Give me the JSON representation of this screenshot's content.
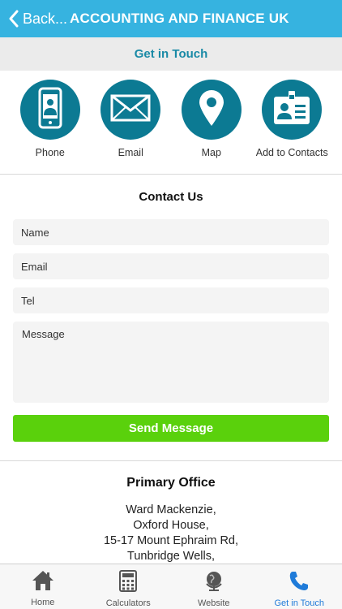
{
  "header": {
    "back_label": "Back...",
    "title": "ACCOUNTING AND FINANCE UK"
  },
  "subheader": {
    "title": "Get in Touch"
  },
  "actions": [
    {
      "label": "Phone",
      "icon": "phone-icon"
    },
    {
      "label": "Email",
      "icon": "email-icon"
    },
    {
      "label": "Map",
      "icon": "map-pin-icon"
    },
    {
      "label": "Add to Contacts",
      "icon": "contact-card-icon"
    }
  ],
  "contact_form": {
    "title": "Contact Us",
    "name_placeholder": "Name",
    "email_placeholder": "Email",
    "tel_placeholder": "Tel",
    "message_placeholder": "Message",
    "send_label": "Send Message"
  },
  "office": {
    "title": "Primary Office",
    "address_lines": [
      "Ward Mackenzie,",
      "Oxford House,",
      "15-17 Mount Ephraim Rd,",
      "Tunbridge Wells,"
    ]
  },
  "tabs": [
    {
      "label": "Home",
      "icon": "home-icon",
      "active": false
    },
    {
      "label": "Calculators",
      "icon": "calculator-icon",
      "active": false
    },
    {
      "label": "Website",
      "icon": "globe-icon",
      "active": false
    },
    {
      "label": "Get in Touch",
      "icon": "phone-handset-icon",
      "active": true
    }
  ],
  "colors": {
    "header_bg": "#36b3e0",
    "accent_teal": "#0c7a93",
    "send_button": "#5ad10c",
    "active_tab": "#1f7bd9"
  }
}
